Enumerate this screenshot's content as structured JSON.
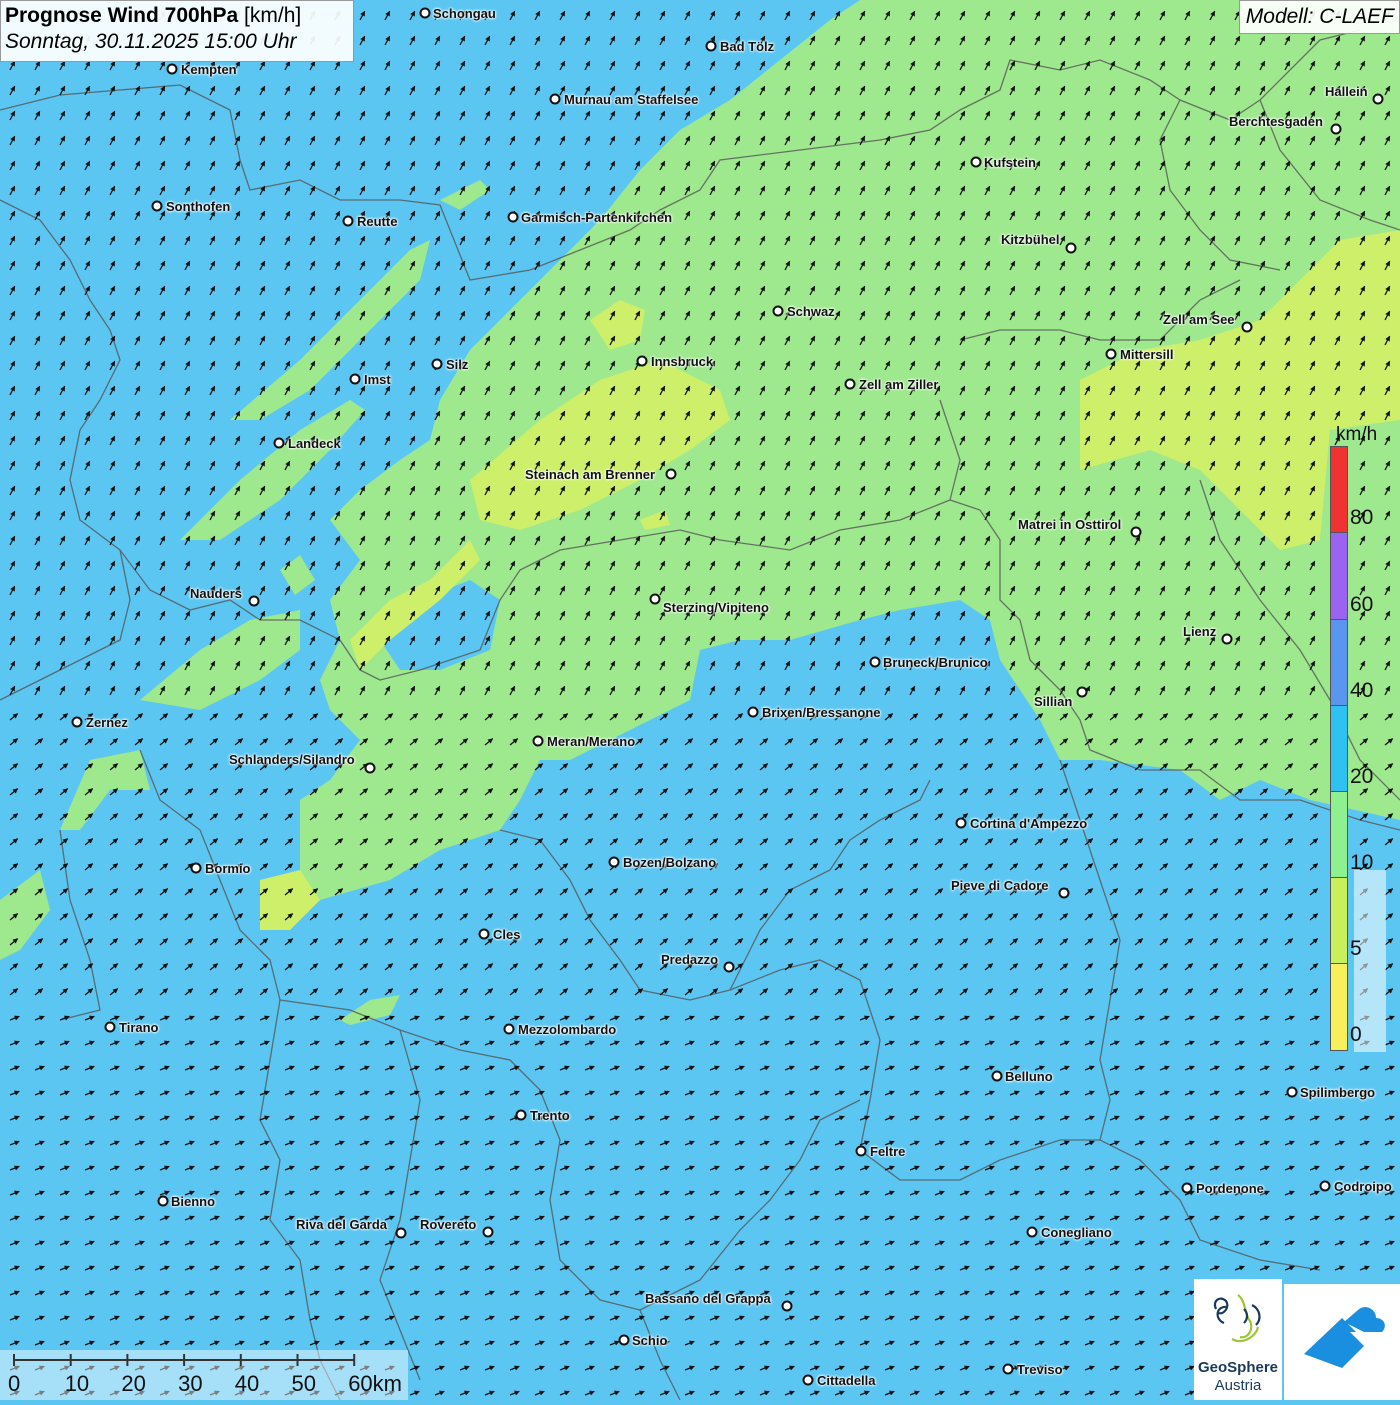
{
  "header": {
    "title_bold": "Prognose Wind 700hPa",
    "title_unit": "[km/h]",
    "datetime": "Sonntag, 30.11.2025 15:00 Uhr"
  },
  "model": "Modell: C-LAEF",
  "colors": {
    "blue_area": "#5cc6f2",
    "green_area": "#9ee88e",
    "yellowgreen_area": "#cdef6a",
    "border": "#555555",
    "arrow": "#111111"
  },
  "places": [
    {
      "name": "Schongau"
    },
    {
      "name": "Bad Tölz"
    },
    {
      "name": "Kempten"
    },
    {
      "name": "Murnau am Staffelsee"
    },
    {
      "name": "Hallein"
    },
    {
      "name": "Berchtesgaden"
    },
    {
      "name": "Kufstein"
    },
    {
      "name": "Sonthofen"
    },
    {
      "name": "Reutte"
    },
    {
      "name": "Garmisch-Partenkirchen"
    },
    {
      "name": "Kitzbühel"
    },
    {
      "name": "Schwaz"
    },
    {
      "name": "Zell am See"
    },
    {
      "name": "Innsbruck"
    },
    {
      "name": "Mittersill"
    },
    {
      "name": "Silz"
    },
    {
      "name": "Imst"
    },
    {
      "name": "Zell am Ziller"
    },
    {
      "name": "Landeck"
    },
    {
      "name": "Steinach am Brenner"
    },
    {
      "name": "Matrei in Osttirol"
    },
    {
      "name": "Nauders"
    },
    {
      "name": "Sterzing/Vipiteno"
    },
    {
      "name": "Lienz"
    },
    {
      "name": "Bruneck/Brunico"
    },
    {
      "name": "Sillian"
    },
    {
      "name": "Zernez"
    },
    {
      "name": "Brixen/Bressanone"
    },
    {
      "name": "Meran/Merano"
    },
    {
      "name": "Schlanders/Silandro"
    },
    {
      "name": "Cortina d'Ampezzo"
    },
    {
      "name": "Bozen/Bolzano"
    },
    {
      "name": "Bormio"
    },
    {
      "name": "Pieve di Cadore"
    },
    {
      "name": "Cles"
    },
    {
      "name": "Predazzo"
    },
    {
      "name": "Tirano"
    },
    {
      "name": "Mezzolombardo"
    },
    {
      "name": "Belluno"
    },
    {
      "name": "Spilimbergo"
    },
    {
      "name": "Trento"
    },
    {
      "name": "Feltre"
    },
    {
      "name": "Pordenone"
    },
    {
      "name": "Codroipo"
    },
    {
      "name": "Bienno"
    },
    {
      "name": "Riva del Garda"
    },
    {
      "name": "Rovereto"
    },
    {
      "name": "Conegliano"
    },
    {
      "name": "Bassano del Grappa"
    },
    {
      "name": "Schio"
    },
    {
      "name": "Treviso"
    },
    {
      "name": "Cittadella"
    }
  ],
  "legend": {
    "unit": "km/h",
    "labels": [
      "80",
      "60",
      "40",
      "20",
      "10",
      "5",
      "0"
    ],
    "segments": [
      {
        "color": "#f03232"
      },
      {
        "color": "#9b64f0"
      },
      {
        "color": "#5a96f0"
      },
      {
        "color": "#2ec2f2"
      },
      {
        "color": "#8ef08e"
      },
      {
        "color": "#c8f05a"
      },
      {
        "color": "#f7f05a"
      }
    ]
  },
  "scale_bar": {
    "labels": [
      "0",
      "10",
      "20",
      "30",
      "40",
      "50",
      "60km"
    ]
  },
  "logo": {
    "name": "GeoSphere",
    "subname": "Austria"
  }
}
